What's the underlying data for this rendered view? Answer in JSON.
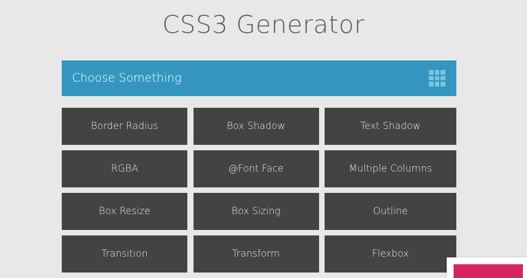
{
  "page": {
    "title": "CSS3 Generator"
  },
  "header": {
    "title": "Choose Something",
    "menu_icon": "grid-icon",
    "background_color": "#3496bf"
  },
  "tiles": [
    {
      "label": "Border Radius"
    },
    {
      "label": "Box Shadow"
    },
    {
      "label": "Text Shadow"
    },
    {
      "label": "RGBA"
    },
    {
      "label": "@Font Face"
    },
    {
      "label": "Multiple Columns"
    },
    {
      "label": "Box Resize"
    },
    {
      "label": "Box Sizing"
    },
    {
      "label": "Outline"
    },
    {
      "label": "Transition"
    },
    {
      "label": "Transform"
    },
    {
      "label": "Flexbox"
    }
  ],
  "colors": {
    "tile_background": "#434343",
    "page_background": "#e8e8e8",
    "accent_pink": "#d6245f"
  }
}
